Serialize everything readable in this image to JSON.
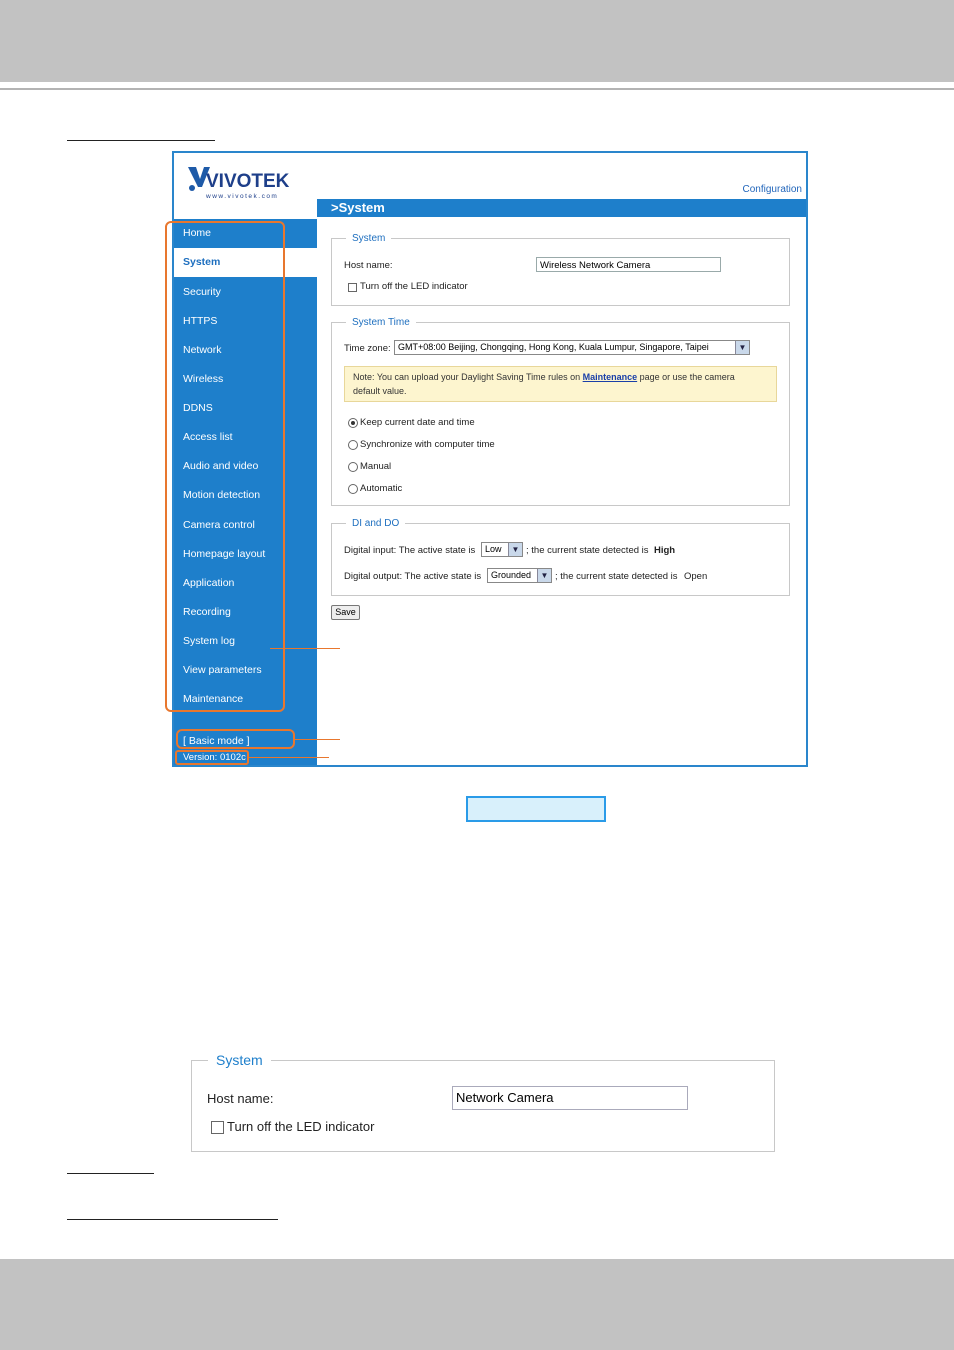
{
  "app": {
    "brand": "VIVOTEK",
    "brand_url_text": "www.vivotek.com",
    "config_link": "Configuration",
    "page_title": ">System"
  },
  "sidebar": {
    "items": [
      {
        "label": "Home"
      },
      {
        "label": "System",
        "active": true
      },
      {
        "label": "Security"
      },
      {
        "label": "HTTPS"
      },
      {
        "label": "Network"
      },
      {
        "label": "Wireless"
      },
      {
        "label": "DDNS"
      },
      {
        "label": "Access list"
      },
      {
        "label": "Audio and video"
      },
      {
        "label": "Motion detection"
      },
      {
        "label": "Camera control"
      },
      {
        "label": "Homepage layout"
      },
      {
        "label": "Application"
      },
      {
        "label": "Recording"
      },
      {
        "label": "System log"
      },
      {
        "label": "View parameters"
      },
      {
        "label": "Maintenance"
      }
    ],
    "basic_mode": "[ Basic mode ]",
    "version": "Version: 0102c"
  },
  "system": {
    "legend": "System",
    "host_label": "Host name:",
    "host_value": "Wireless Network Camera",
    "led_label": "Turn off the LED indicator"
  },
  "system_time": {
    "legend": "System Time",
    "tz_label": "Time zone:",
    "tz_value": "GMT+08:00 Beijing, Chongqing, Hong Kong, Kuala Lumpur, Singapore, Taipei",
    "note_pre": "Note: You can upload your Daylight Saving Time rules on ",
    "note_link": "Maintenance",
    "note_post": " page or use the camera",
    "note_line2": "default value.",
    "options": [
      {
        "label": "Keep current date and time",
        "selected": true
      },
      {
        "label": "Synchronize with computer time"
      },
      {
        "label": "Manual"
      },
      {
        "label": "Automatic"
      }
    ]
  },
  "dido": {
    "legend": "DI and DO",
    "di_pre": "Digital input: The active state is",
    "di_value": "Low",
    "di_post": "; the current state detected is",
    "di_state": "High",
    "do_pre": "Digital output: The active state is",
    "do_value": "Grounded",
    "do_post": "; the current state detected is",
    "do_state": "Open"
  },
  "save_label": "Save",
  "detail": {
    "legend": "System",
    "host_label": "Host name:",
    "host_value": "Network Camera",
    "led_label": "Turn off the LED indicator"
  },
  "colors": {
    "sidebar": "#1e7fcb",
    "highlight": "#e8772e",
    "caption_border": "#2a9be8",
    "note_bg": "#fdf5cf"
  }
}
